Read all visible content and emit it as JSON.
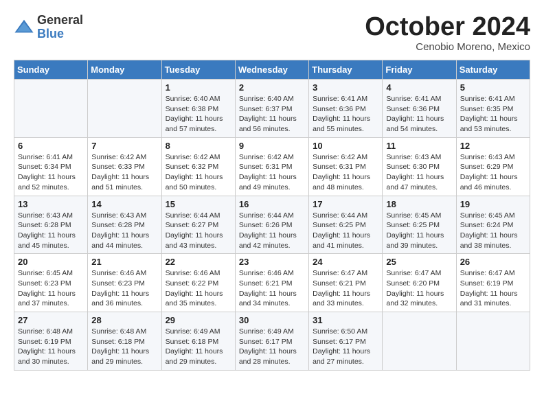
{
  "logo": {
    "general": "General",
    "blue": "Blue"
  },
  "title": "October 2024",
  "subtitle": "Cenobio Moreno, Mexico",
  "days_of_week": [
    "Sunday",
    "Monday",
    "Tuesday",
    "Wednesday",
    "Thursday",
    "Friday",
    "Saturday"
  ],
  "weeks": [
    [
      {
        "day": "",
        "info": ""
      },
      {
        "day": "",
        "info": ""
      },
      {
        "day": "1",
        "info": "Sunrise: 6:40 AM\nSunset: 6:38 PM\nDaylight: 11 hours\nand 57 minutes."
      },
      {
        "day": "2",
        "info": "Sunrise: 6:40 AM\nSunset: 6:37 PM\nDaylight: 11 hours\nand 56 minutes."
      },
      {
        "day": "3",
        "info": "Sunrise: 6:41 AM\nSunset: 6:36 PM\nDaylight: 11 hours\nand 55 minutes."
      },
      {
        "day": "4",
        "info": "Sunrise: 6:41 AM\nSunset: 6:36 PM\nDaylight: 11 hours\nand 54 minutes."
      },
      {
        "day": "5",
        "info": "Sunrise: 6:41 AM\nSunset: 6:35 PM\nDaylight: 11 hours\nand 53 minutes."
      }
    ],
    [
      {
        "day": "6",
        "info": "Sunrise: 6:41 AM\nSunset: 6:34 PM\nDaylight: 11 hours\nand 52 minutes."
      },
      {
        "day": "7",
        "info": "Sunrise: 6:42 AM\nSunset: 6:33 PM\nDaylight: 11 hours\nand 51 minutes."
      },
      {
        "day": "8",
        "info": "Sunrise: 6:42 AM\nSunset: 6:32 PM\nDaylight: 11 hours\nand 50 minutes."
      },
      {
        "day": "9",
        "info": "Sunrise: 6:42 AM\nSunset: 6:31 PM\nDaylight: 11 hours\nand 49 minutes."
      },
      {
        "day": "10",
        "info": "Sunrise: 6:42 AM\nSunset: 6:31 PM\nDaylight: 11 hours\nand 48 minutes."
      },
      {
        "day": "11",
        "info": "Sunrise: 6:43 AM\nSunset: 6:30 PM\nDaylight: 11 hours\nand 47 minutes."
      },
      {
        "day": "12",
        "info": "Sunrise: 6:43 AM\nSunset: 6:29 PM\nDaylight: 11 hours\nand 46 minutes."
      }
    ],
    [
      {
        "day": "13",
        "info": "Sunrise: 6:43 AM\nSunset: 6:28 PM\nDaylight: 11 hours\nand 45 minutes."
      },
      {
        "day": "14",
        "info": "Sunrise: 6:43 AM\nSunset: 6:28 PM\nDaylight: 11 hours\nand 44 minutes."
      },
      {
        "day": "15",
        "info": "Sunrise: 6:44 AM\nSunset: 6:27 PM\nDaylight: 11 hours\nand 43 minutes."
      },
      {
        "day": "16",
        "info": "Sunrise: 6:44 AM\nSunset: 6:26 PM\nDaylight: 11 hours\nand 42 minutes."
      },
      {
        "day": "17",
        "info": "Sunrise: 6:44 AM\nSunset: 6:25 PM\nDaylight: 11 hours\nand 41 minutes."
      },
      {
        "day": "18",
        "info": "Sunrise: 6:45 AM\nSunset: 6:25 PM\nDaylight: 11 hours\nand 39 minutes."
      },
      {
        "day": "19",
        "info": "Sunrise: 6:45 AM\nSunset: 6:24 PM\nDaylight: 11 hours\nand 38 minutes."
      }
    ],
    [
      {
        "day": "20",
        "info": "Sunrise: 6:45 AM\nSunset: 6:23 PM\nDaylight: 11 hours\nand 37 minutes."
      },
      {
        "day": "21",
        "info": "Sunrise: 6:46 AM\nSunset: 6:23 PM\nDaylight: 11 hours\nand 36 minutes."
      },
      {
        "day": "22",
        "info": "Sunrise: 6:46 AM\nSunset: 6:22 PM\nDaylight: 11 hours\nand 35 minutes."
      },
      {
        "day": "23",
        "info": "Sunrise: 6:46 AM\nSunset: 6:21 PM\nDaylight: 11 hours\nand 34 minutes."
      },
      {
        "day": "24",
        "info": "Sunrise: 6:47 AM\nSunset: 6:21 PM\nDaylight: 11 hours\nand 33 minutes."
      },
      {
        "day": "25",
        "info": "Sunrise: 6:47 AM\nSunset: 6:20 PM\nDaylight: 11 hours\nand 32 minutes."
      },
      {
        "day": "26",
        "info": "Sunrise: 6:47 AM\nSunset: 6:19 PM\nDaylight: 11 hours\nand 31 minutes."
      }
    ],
    [
      {
        "day": "27",
        "info": "Sunrise: 6:48 AM\nSunset: 6:19 PM\nDaylight: 11 hours\nand 30 minutes."
      },
      {
        "day": "28",
        "info": "Sunrise: 6:48 AM\nSunset: 6:18 PM\nDaylight: 11 hours\nand 29 minutes."
      },
      {
        "day": "29",
        "info": "Sunrise: 6:49 AM\nSunset: 6:18 PM\nDaylight: 11 hours\nand 29 minutes."
      },
      {
        "day": "30",
        "info": "Sunrise: 6:49 AM\nSunset: 6:17 PM\nDaylight: 11 hours\nand 28 minutes."
      },
      {
        "day": "31",
        "info": "Sunrise: 6:50 AM\nSunset: 6:17 PM\nDaylight: 11 hours\nand 27 minutes."
      },
      {
        "day": "",
        "info": ""
      },
      {
        "day": "",
        "info": ""
      }
    ]
  ]
}
